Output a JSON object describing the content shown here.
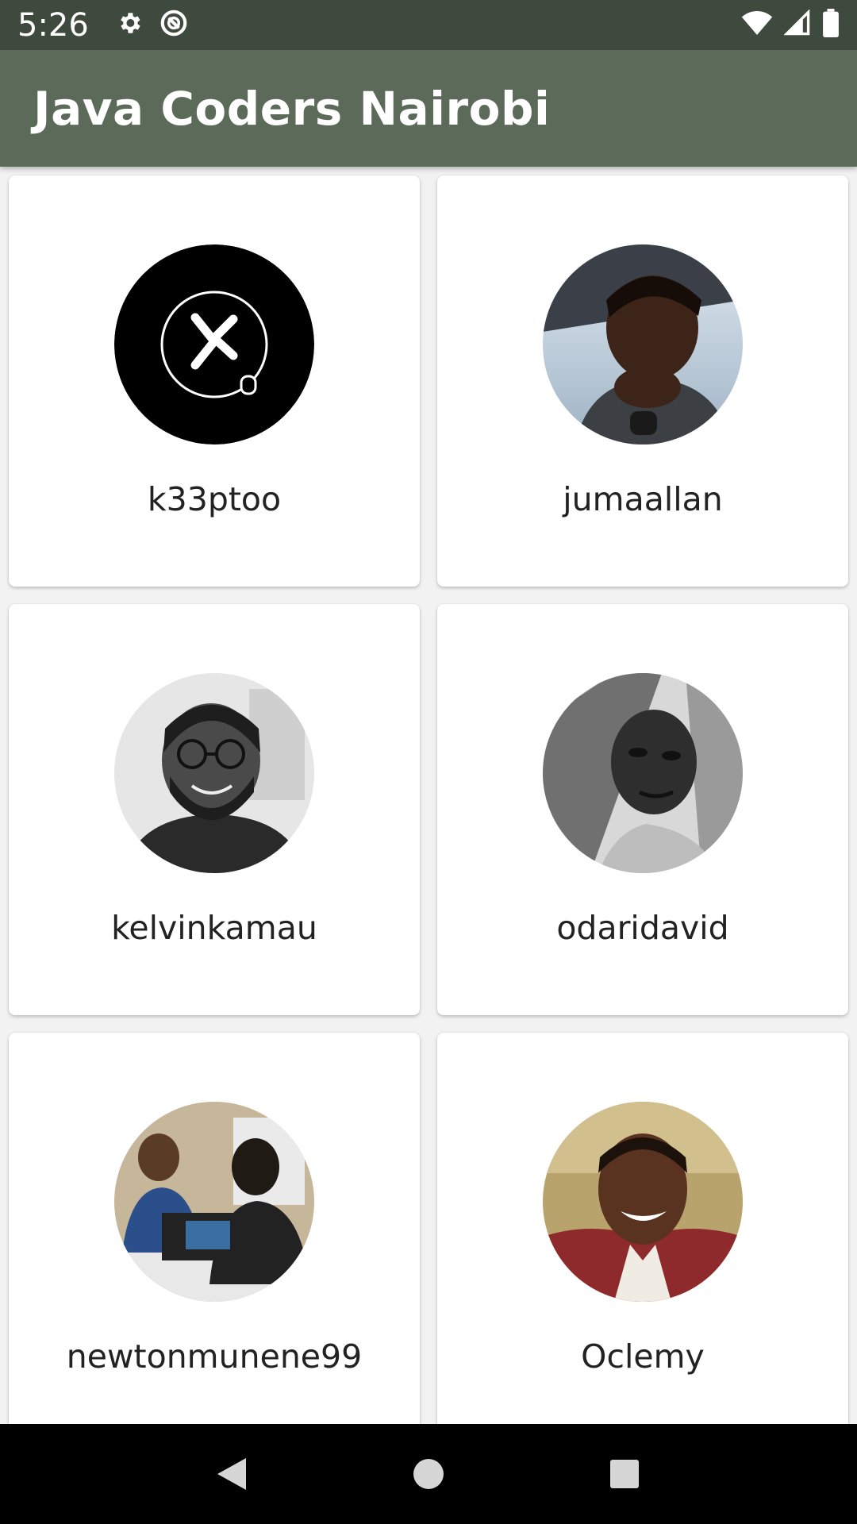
{
  "status_bar": {
    "time": "5:26",
    "left_icons": [
      "gear-icon",
      "no-sync-icon"
    ],
    "right_icons": [
      "wifi-icon",
      "cellular-signal-icon",
      "battery-icon"
    ]
  },
  "app_bar": {
    "title": "Java Coders Nairobi",
    "color": "#5c6b59"
  },
  "users": [
    {
      "username": "k33ptoo",
      "avatar": "logo-avatar"
    },
    {
      "username": "jumaallan",
      "avatar": "photo-avatar"
    },
    {
      "username": "kelvinkamau",
      "avatar": "photo-avatar"
    },
    {
      "username": "odaridavid",
      "avatar": "photo-avatar"
    },
    {
      "username": "newtonmunene99",
      "avatar": "photo-avatar"
    },
    {
      "username": "Oclemy",
      "avatar": "photo-avatar"
    }
  ],
  "nav_bar": {
    "buttons": [
      "back-icon",
      "home-icon",
      "recents-icon"
    ]
  }
}
